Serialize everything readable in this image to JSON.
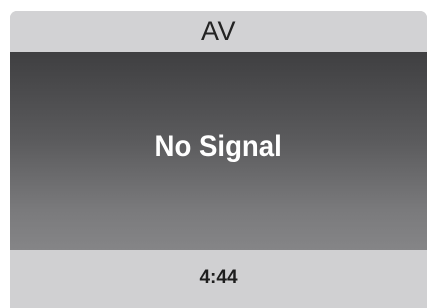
{
  "header": {
    "title": "AV"
  },
  "display": {
    "status_message": "No Signal"
  },
  "footer": {
    "time": "4:44"
  },
  "colors": {
    "title_bar": "#d2d2d4",
    "display_top": "#3f3f41",
    "display_bottom": "#858587",
    "footer_bar": "#d0d0d2",
    "title_text": "#232323",
    "message_text": "#ffffff"
  }
}
